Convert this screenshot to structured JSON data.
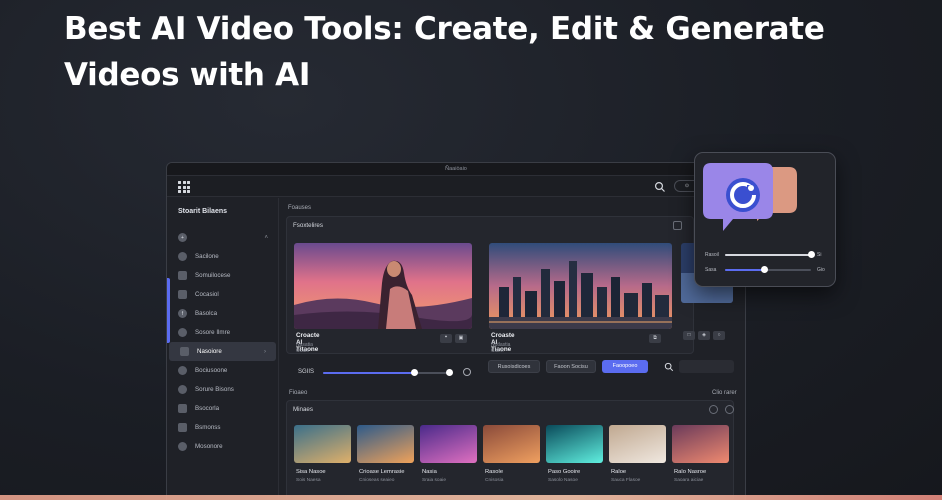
{
  "headline": "Best AI Video Tools: Create, Edit & Generate Videos with AI",
  "window": {
    "title": "Ñaaiòaio"
  },
  "topbar": {
    "pill_label": "⊙"
  },
  "sidebar": {
    "title": "Stoarit Bilaens",
    "items": [
      {
        "label": "",
        "icon": "plus-icon"
      },
      {
        "label": "Sacilone",
        "icon": "circle-icon"
      },
      {
        "label": "Somuilocese",
        "icon": "grid-icon"
      },
      {
        "label": "Cocasiol",
        "icon": "square-icon"
      },
      {
        "label": "Basolca",
        "icon": "facebook-icon"
      },
      {
        "label": "Sosore Ilmre",
        "icon": "circle-icon"
      },
      {
        "label": "Nasoiore",
        "icon": "square-icon"
      },
      {
        "label": "Bociusoone",
        "icon": "circle-icon"
      },
      {
        "label": "Sorure Bisons",
        "icon": "circle-icon"
      },
      {
        "label": "Bsocorla",
        "icon": "image-icon"
      },
      {
        "label": "Bsmonss",
        "icon": "square-icon"
      },
      {
        "label": "Mosonore",
        "icon": "circle-icon"
      }
    ],
    "active_index": 6
  },
  "main": {
    "section_label": "Foauses",
    "panel_title": "Fsoxtelires",
    "cards": [
      {
        "title": "Croacte Al Titaone",
        "sub": "Nasatia Ocaio"
      },
      {
        "title": "Croaste Al Tiaone",
        "sub": "Notlastia Cisim"
      }
    ],
    "slider_label": "SGIIS",
    "slider_value": 0.71,
    "chips": [
      "Rusoisdicoes",
      "Faoon Socisu",
      "Faoopoeo"
    ]
  },
  "strip": {
    "section_label": "Fioaeo",
    "right_label": "Clio rarer",
    "panel_title": "Minaes",
    "items": [
      {
        "title": "Sisa Nasoe",
        "sub": "Sois Naesa"
      },
      {
        "title": "Crioase Lemrasie",
        "sub": "Cnioseas seaieo"
      },
      {
        "title": "Nasia",
        "sub": "Sraia soaie"
      },
      {
        "title": "Rasole",
        "sub": "Cnisosia"
      },
      {
        "title": "Paso Gooire",
        "sub": "Sasolo Nasoe"
      },
      {
        "title": "Raloe",
        "sub": "Sauca Flasoe"
      },
      {
        "title": "Ralo Nasroe",
        "sub": "Saoara aiciae"
      }
    ]
  },
  "float_card": {
    "rows": [
      {
        "label": "Rasoil",
        "value": "Si",
        "level": 1.0
      },
      {
        "label": "Sasa",
        "value": "Gio",
        "level": 0.45
      }
    ]
  },
  "colors": {
    "accent": "#5b6cf0",
    "background": "#1b1e25",
    "panel": "#24262d"
  }
}
